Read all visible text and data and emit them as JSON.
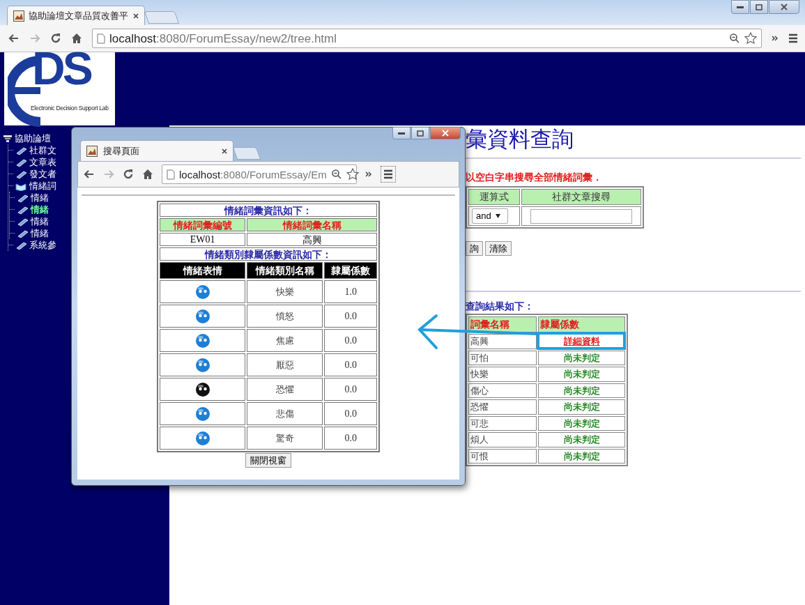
{
  "browser": {
    "tab_title": "協助論壇文章品質改善平",
    "url_host": "localhost",
    "url_path": ":8080/ForumEssay/new2/tree.html"
  },
  "logo": {
    "letters": "DS",
    "tagline": "Electronic Decision Support Lab"
  },
  "sidebar": {
    "items": [
      {
        "label": "協助論壇",
        "selected": false,
        "expanded": true,
        "children": [
          {
            "label": "社群文",
            "selected": false
          },
          {
            "label": "文章表",
            "selected": false
          },
          {
            "label": "發文者",
            "selected": false
          },
          {
            "label": "情緒詞",
            "selected": false,
            "expanded": true,
            "children": [
              {
                "label": "情緒",
                "selected": false
              },
              {
                "label": "情緒",
                "selected": true
              },
              {
                "label": "情緒",
                "selected": false
              },
              {
                "label": "情緒",
                "selected": false
              }
            ]
          },
          {
            "label": "系統參",
            "selected": false
          }
        ]
      }
    ]
  },
  "main": {
    "title": "彙資料查詢",
    "hint": "以空白字串搜尋全部情緒詞彙．",
    "search_table": {
      "columns": [
        "運算式",
        "社群文章搜尋"
      ],
      "operator": "and"
    },
    "buttons": [
      "詢",
      "清除"
    ],
    "results_heading": "查詢結果如下：",
    "results": {
      "columns": [
        "詞彙名稱",
        "隸屬係數"
      ],
      "rows": [
        {
          "term": "高興",
          "status": "詳細資料",
          "kind": "link"
        },
        {
          "term": "可怕",
          "status": "尚未判定",
          "kind": "text"
        },
        {
          "term": "快樂",
          "status": "尚未判定",
          "kind": "text"
        },
        {
          "term": "傷心",
          "status": "尚未判定",
          "kind": "text"
        },
        {
          "term": "恐懼",
          "status": "尚未判定",
          "kind": "text"
        },
        {
          "term": "可悲",
          "status": "尚未判定",
          "kind": "text"
        },
        {
          "term": "煩人",
          "status": "尚未判定",
          "kind": "text"
        },
        {
          "term": "可恨",
          "status": "尚未判定",
          "kind": "text"
        }
      ]
    }
  },
  "popup": {
    "tab_title": "搜尋頁面",
    "url_host": "localhost",
    "url_path": ":8080/ForumEssay/Em",
    "caption": "情緒詞彙資訊如下：",
    "term_columns": [
      "情緒詞彙編號",
      "情緒詞彙名稱"
    ],
    "term_values": [
      "EW01",
      "高興"
    ],
    "category_caption": "情緒類別隸屬係數資訊如下：",
    "category_columns": [
      "情緒表情",
      "情緒類別名稱",
      "隸屬係數"
    ],
    "categories": [
      {
        "color": "#1e7fd6",
        "name": "快樂",
        "value": "1.0"
      },
      {
        "color": "#1e7fd6",
        "name": "憤怒",
        "value": "0.0"
      },
      {
        "color": "#1e7fd6",
        "name": "焦慮",
        "value": "0.0"
      },
      {
        "color": "#1e7fd6",
        "name": "厭惡",
        "value": "0.0"
      },
      {
        "color": "#111111",
        "name": "恐懼",
        "value": "0.0"
      },
      {
        "color": "#1e7fd6",
        "name": "悲傷",
        "value": "0.0"
      },
      {
        "color": "#1e7fd6",
        "name": "驚奇",
        "value": "0.0"
      }
    ],
    "close_button": "關閉視窗"
  }
}
